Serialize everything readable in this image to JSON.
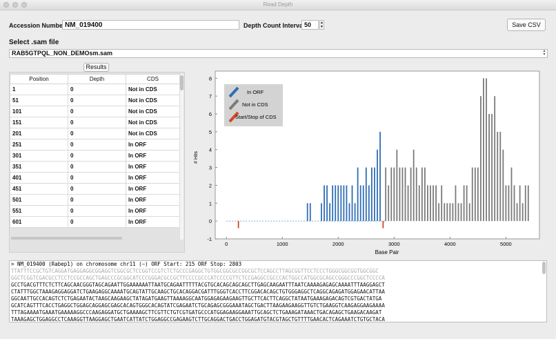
{
  "window": {
    "title": "Read Depth"
  },
  "form": {
    "accession_label": "Accession Number",
    "accession_value": "NM_019400",
    "interval_label": "Depth Count Interval",
    "interval_value": "50",
    "save_label": "Save CSV",
    "sam_label": "Select .sam file",
    "sam_value": "RAB5GTPQL_NON_DEMOsm.sam"
  },
  "results": {
    "button_label": "Results",
    "headers": [
      "Position",
      "Depth",
      "CDS"
    ],
    "rows": [
      [
        "1",
        "0",
        "Not in CDS"
      ],
      [
        "51",
        "0",
        "Not in CDS"
      ],
      [
        "101",
        "0",
        "Not in CDS"
      ],
      [
        "151",
        "0",
        "Not in CDS"
      ],
      [
        "201",
        "0",
        "Not in CDS"
      ],
      [
        "251",
        "0",
        "In ORF"
      ],
      [
        "301",
        "0",
        "In ORF"
      ],
      [
        "351",
        "0",
        "In ORF"
      ],
      [
        "401",
        "0",
        "In ORF"
      ],
      [
        "451",
        "0",
        "In ORF"
      ],
      [
        "501",
        "0",
        "In ORF"
      ],
      [
        "551",
        "0",
        "In ORF"
      ],
      [
        "601",
        "0",
        "In ORF"
      ]
    ]
  },
  "chart_data": {
    "type": "bar",
    "xlabel": "Base Pair",
    "ylabel": "# Hits",
    "xlim": [
      -200,
      5600
    ],
    "ylim": [
      -1,
      8.4
    ],
    "xticks": [
      0,
      1000,
      2000,
      3000,
      4000,
      5000
    ],
    "yticks": [
      -1,
      0,
      1,
      2,
      3,
      4,
      5,
      6,
      7,
      8
    ],
    "legend_position": "top-left",
    "colors": {
      "in_orf": "#2f6db5",
      "not_in_cds": "#7a7a7a",
      "start_stop": "#d0462a"
    },
    "series": [
      {
        "name": "In ORF",
        "x": [
          1450,
          1500,
          1700,
          1750,
          1800,
          1850,
          1900,
          1950,
          2000,
          2050,
          2100,
          2150,
          2200,
          2250,
          2300,
          2350,
          2400,
          2450,
          2500,
          2550,
          2600,
          2650,
          2700,
          2750
        ],
        "values": [
          1,
          1,
          1,
          2,
          2,
          1,
          2,
          2,
          2,
          2,
          2,
          2,
          1,
          2,
          1,
          3,
          2,
          2,
          3,
          2,
          3,
          3,
          4,
          5
        ]
      },
      {
        "name": "Not in CDS",
        "x": [
          2850,
          2900,
          2950,
          3000,
          3050,
          3100,
          3150,
          3200,
          3250,
          3300,
          3350,
          3400,
          3450,
          3500,
          3550,
          3600,
          3650,
          3700,
          3750,
          3800,
          3850,
          3900,
          3950,
          4000,
          4050,
          4100,
          4150,
          4200,
          4250,
          4300,
          4350,
          4400,
          4450,
          4500,
          4550,
          4600,
          4650,
          4700,
          4750,
          4800,
          4850,
          4900,
          4950,
          5000,
          5050,
          5100,
          5150,
          5200,
          5250,
          5300,
          5350,
          5400
        ],
        "values": [
          3,
          2,
          3,
          3,
          4,
          3,
          3,
          3,
          2,
          3,
          4,
          3,
          2,
          3,
          3,
          2,
          2,
          2,
          2,
          1,
          2,
          1,
          1,
          1,
          1,
          2,
          1,
          1,
          2,
          2,
          1,
          3,
          3,
          3,
          7,
          8,
          8,
          6,
          6,
          7,
          5,
          5,
          4,
          2,
          2,
          3,
          2,
          1,
          2,
          1,
          2,
          2
        ]
      },
      {
        "name": "Start/Stop of CDS",
        "x": [
          215,
          2803
        ],
        "values": [
          -0.4,
          -0.4
        ]
      }
    ]
  },
  "sequence": {
    "header": "> NM_019400 (Rabep1) on chromosome chr11 (—) ORF Start: 215 ORF Stop: 2803",
    "lines": [
      "TTATTTCCGCTGTCAGGATGAGGAGGCGGAGGTCGGCGCTCCGGTCCGTCTCTGCCCGAGGCTGTGGCGGCGCCGGCGCTCCAGCCTTAGCGGTTCCTCCCTGGGCGGCGGTGGCGGC",
      "GGCTCGGTCGACGCCTCCTCCGCCAGCTGAGCCCGCGGCATCCCGGGACGCCGCTTCCCCGCCCATCCCCGTTCTCCGAGGCCGCCCACTGGCCATGGCGCAGCCGGGCCCGGCTCCCCA",
      "GCCTGACGTTTCTCTTCAGCAACGGGTAGCAGAATTGGAAAAAATTAATGCAGAATTTTTACGTGCACAGCAGCAGCTTGAGCAAGAATTTAATCAAAAGAGAGCAAAATTTAAGGAGCT",
      "CTATTTGGCTAAAGAGGAGGATCTGAAGAGGCAAAATGCAGTATTGCAAGCTGCACAGGACGATTTGGGTCACCTTCGGACACAGCTGTGGGAGGCTCAGGCAGAGATGGAGAACATTAA",
      "GGCAATTGCCACAGTCTCTGAGAATACTAAGCAAGAAGCTATAGATGAAGTTAAAAGGCAATGGAGAGAAGAAGTTGCTTCACTTCAGGCTATAATGAAAGAGACAGTCGTGACTATGA",
      "GCATCAGTTTCACCTGAGGCTGGAGCAGGAGCGAGCACAGTGGGCACAGTATCGAGAATCTGCAGAGCGGGAAATAGCTGACTTAAGAAGAAGGTTGTCTGAAGGTCAAGAGGAAGAAAA",
      "TTTAGAAAATGAAATGAAAAAGGCCCAAGAGGATGCTGAAAAGCTTCGTTCTGTCGTGATGCCCATGGAGAAGGAAATTGCAGCTCTGAAAGATAAACTGACAGAGCTGAAGACAAGAT",
      "TAAAGAGCTGGAGGCCTCAAAGGTTAAGGAGCTGAATCATTATCTGGAGGCCGAGAAGTCTTGCAGGACTGACCTGGAGATGTACGTAGCTGTTTTGAACACTCAGAAATCTGTGCTACA"
    ]
  }
}
